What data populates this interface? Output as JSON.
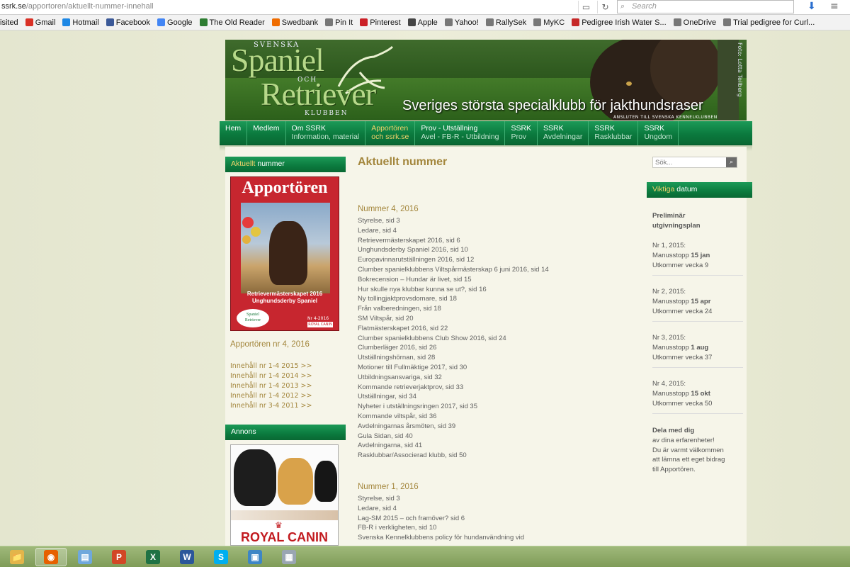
{
  "browser": {
    "url_host": "ssrk.se",
    "url_path": "/apportoren/aktuellt-nummer-innehall",
    "search_placeholder": "Search",
    "bookmarks": [
      {
        "label": "isited",
        "icon": "none",
        "color": "#f2f2f2"
      },
      {
        "label": "Gmail",
        "icon": "gmail-icon",
        "color": "#d93025"
      },
      {
        "label": "Hotmail",
        "icon": "windows-icon",
        "color": "#1e88e5"
      },
      {
        "label": "Facebook",
        "icon": "facebook-icon",
        "color": "#3b5998"
      },
      {
        "label": "Google",
        "icon": "google-icon",
        "color": "#4285f4"
      },
      {
        "label": "The Old Reader",
        "icon": "reader-icon",
        "color": "#2e7d32"
      },
      {
        "label": "Swedbank",
        "icon": "swedbank-icon",
        "color": "#ef6c00"
      },
      {
        "label": "Pin It",
        "icon": "globe-icon",
        "color": "#777777"
      },
      {
        "label": "Pinterest",
        "icon": "pinterest-icon",
        "color": "#cb2027"
      },
      {
        "label": "Apple",
        "icon": "apple-icon",
        "color": "#444444"
      },
      {
        "label": "Yahoo!",
        "icon": "globe-icon",
        "color": "#777777"
      },
      {
        "label": "RallySek",
        "icon": "globe-icon",
        "color": "#777777"
      },
      {
        "label": "MyKC",
        "icon": "globe-icon",
        "color": "#777777"
      },
      {
        "label": "Pedigree Irish Water S...",
        "icon": "star-icon",
        "color": "#c62828"
      },
      {
        "label": "OneDrive",
        "icon": "globe-icon",
        "color": "#777777"
      },
      {
        "label": "Trial pedigree for Curl...",
        "icon": "globe-icon",
        "color": "#777777"
      }
    ]
  },
  "banner": {
    "svenska": "SVENSKA",
    "spaniel": "Spaniel",
    "och": "OCH",
    "retriever": "Retriever",
    "klubben": "KLUBBEN",
    "tagline": "Sveriges största specialklubb för jakthundsraser",
    "sub": "ANSLUTEN TILL SVENSKA KENNELKLUBBEN",
    "foto": "Foto: Lotta Teilberg"
  },
  "nav": [
    {
      "label": "Hem",
      "sub": "",
      "active": false
    },
    {
      "label": "Medlem",
      "sub": "",
      "active": false
    },
    {
      "label": "Om SSRK",
      "sub": "Information, material",
      "active": false
    },
    {
      "label": "Apportören",
      "sub": "och ssrk.se",
      "active": true
    },
    {
      "label": "Prov - Utställning",
      "sub": "Avel - FB-R - Utbildning",
      "active": false
    },
    {
      "label": "SSRK",
      "sub": "Prov",
      "active": false
    },
    {
      "label": "SSRK",
      "sub": "Avdelningar",
      "active": false
    },
    {
      "label": "SSRK",
      "sub": "Rasklubbar",
      "active": false
    },
    {
      "label": "SSRK",
      "sub": "Ungdom",
      "active": false
    }
  ],
  "left": {
    "box1_hl": "Aktuellt",
    "box1_rest": " nummer",
    "cover": {
      "title": "Apportören",
      "headline1": "Retrievermästerskapet 2016",
      "headline2": "Unghundsderby Spaniel",
      "logo1": "Spaniel",
      "logo2": "Retriever",
      "issue": "Nr 4-2016",
      "sponsor": "ROYAL CANIN"
    },
    "current_title": "Apportören nr 4, 2016",
    "archive": [
      "Innehåll nr 1-4 2015 >>",
      "Innehåll nr 1-4 2014 >>",
      "Innehåll nr 1-4 2013 >>",
      "Innehåll nr 1-4 2012 >>",
      "Innehåll nr 3-4 2011 >>"
    ],
    "ad_head": "Annons",
    "ad_brand": "ROYAL CANIN"
  },
  "main": {
    "heading": "Aktuellt nummer",
    "issues": [
      {
        "title": "Nummer 4, 2016",
        "items": [
          "Styrelse, sid 3",
          "Ledare, sid 4",
          "Retrievermästerskapet 2016, sid 6",
          "Unghundsderby Spaniel 2016, sid 10",
          "Europavinnarutställningen 2016, sid 12",
          "Clumber spanielklubbens Viltspårmästerskap 6 juni 2016, sid 14",
          "Bokrecension – Hundar är livet, sid 15",
          "Hur skulle nya klubbar kunna se ut?, sid 16",
          "Ny tollingjaktprovsdomare, sid 18",
          "Från valberedningen, sid 18",
          "SM Viltspår, sid 20",
          "Flatmästerskapet 2016, sid 22",
          "Clumber spanielklubbens Club Show 2016, sid 24",
          "Clumberläger 2016, sid 26",
          "Utställningshörnan, sid 28",
          "Motioner till Fullmäktige 2017, sid 30",
          "Utbildningsansvariga, sid 32",
          "Kommande retrieverjaktprov, sid 33",
          "Utställningar, sid 34",
          "Nyheter i utställningsringen 2017, sid 35",
          "Kommande viltspår, sid 36",
          "Avdelningarnas årsmöten, sid 39",
          "Gula Sidan, sid 40",
          "Avdelningarna, sid 41",
          "Rasklubbar/Associerad klubb, sid 50"
        ]
      },
      {
        "title": "Nummer 1, 2016",
        "items": [
          "Styrelse, sid 3",
          "Ledare, sid 4",
          "Lag-SM 2015 – och framöver? sid 6",
          "FB-R i verkligheten, sid 10",
          "Svenska Kennelklubbens policy för hundanvändning vid"
        ]
      }
    ]
  },
  "right": {
    "search_placeholder": "Sök...",
    "box_hl": "Viktiga",
    "box_rest": " datum",
    "plan_title1": "Preliminär",
    "plan_title2": "utgivningsplan",
    "entries": [
      {
        "nr": "Nr 1, 2015:",
        "label": "Manusstopp ",
        "date": "15 jan",
        "week": "Utkommer vecka 9"
      },
      {
        "nr": "Nr 2, 2015:",
        "label": "Manusstopp ",
        "date": "15 apr",
        "week": "Utkommer vecka 24"
      },
      {
        "nr": "Nr 3, 2015:",
        "label": "Manusstopp ",
        "date": "1 aug",
        "week": "Utkommer vecka 37"
      },
      {
        "nr": "Nr 4, 2015:",
        "label": "Manusstopp ",
        "date": "15 okt",
        "week": "Utkommer vecka 50"
      }
    ],
    "share_title": "Dela med dig",
    "share_lines": [
      "av dina erfarenheter!",
      "Du är varmt välkommen",
      "att lämna ett eget bidrag",
      "till Apportören."
    ]
  },
  "taskbar": [
    {
      "icon": "folder-icon",
      "glyph": "📁",
      "bg": "#e3b54a",
      "active": false
    },
    {
      "icon": "firefox-icon",
      "glyph": "◉",
      "bg": "#e66000",
      "active": true
    },
    {
      "icon": "notepad-icon",
      "glyph": "▤",
      "bg": "#6fa8dc",
      "active": false
    },
    {
      "icon": "powerpoint-icon",
      "glyph": "P",
      "bg": "#d24726",
      "active": false
    },
    {
      "icon": "excel-icon",
      "glyph": "X",
      "bg": "#1f7244",
      "active": false
    },
    {
      "icon": "word-icon",
      "glyph": "W",
      "bg": "#2b579a",
      "active": false
    },
    {
      "icon": "skype-icon",
      "glyph": "S",
      "bg": "#00aff0",
      "active": false
    },
    {
      "icon": "photos-icon",
      "glyph": "▣",
      "bg": "#3d86c6",
      "active": false
    },
    {
      "icon": "calculator-icon",
      "glyph": "▦",
      "bg": "#9aa6b2",
      "active": false
    }
  ]
}
